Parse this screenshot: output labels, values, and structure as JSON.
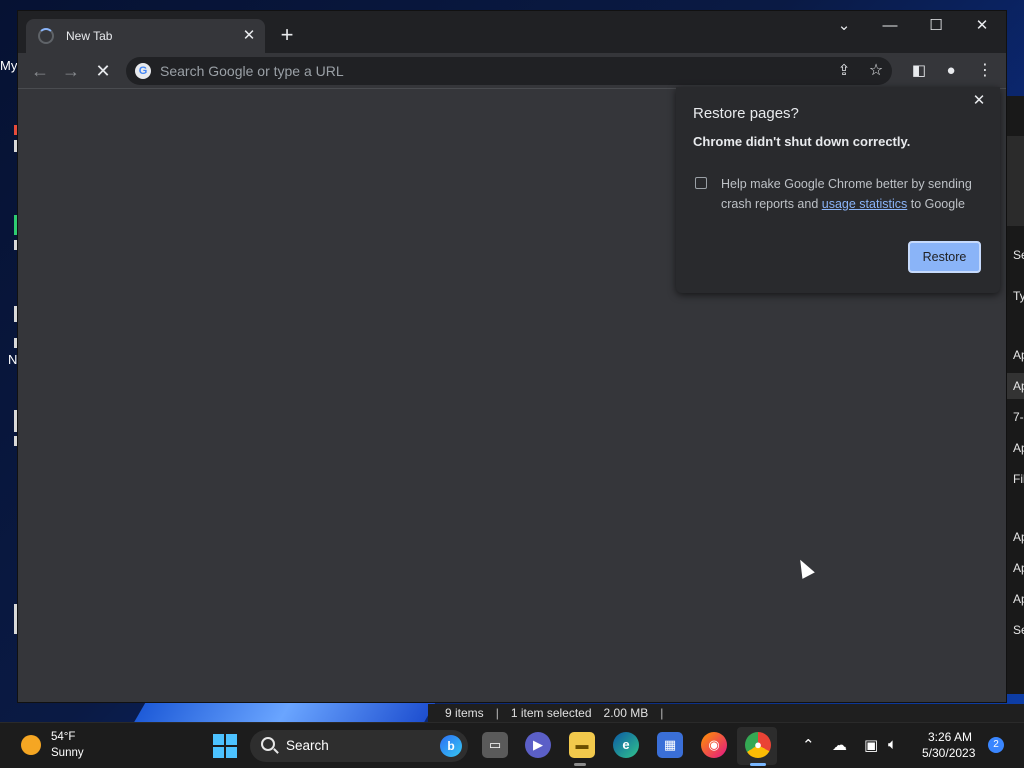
{
  "desktop": {
    "fragments": [
      "My",
      "N"
    ]
  },
  "explorer": {
    "rows": [
      "Se",
      "Ty",
      "Ap",
      "Ap",
      "7-",
      "Ap",
      "Fil",
      "Ap",
      "Ap",
      "Ap",
      "Se"
    ],
    "status": {
      "items": "9 items",
      "selected": "1 item selected",
      "size": "2.00 MB"
    }
  },
  "chrome": {
    "tab": {
      "title": "New Tab"
    },
    "omnibox": {
      "placeholder": "Search Google or type a URL"
    },
    "restore_popup": {
      "title": "Restore pages?",
      "subtitle": "Chrome didn't shut down correctly.",
      "help_prefix": "Help make Google Chrome better by sending crash reports and",
      "help_link": "usage statistics",
      "help_suffix": "to Google",
      "button": "Restore"
    }
  },
  "taskbar": {
    "weather": {
      "temp": "54°F",
      "condition": "Sunny"
    },
    "search_label": "Search",
    "clock": {
      "time": "3:26 AM",
      "date": "5/30/2023"
    },
    "notification_count": "2"
  },
  "icons": {
    "start": "windows-start-icon",
    "chrome": "chrome-icon",
    "explorer": "file-explorer-icon",
    "edge": "edge-icon",
    "store": "store-icon",
    "firefox": "firefox-icon",
    "teams": "teams-chat-icon",
    "taskview": "task-view-icon"
  },
  "colors": {
    "chrome_frame": "#202124",
    "chrome_toolbar": "#35363a",
    "accent_blue": "#8ab4f8",
    "taskbar": "#1c1c1c"
  }
}
